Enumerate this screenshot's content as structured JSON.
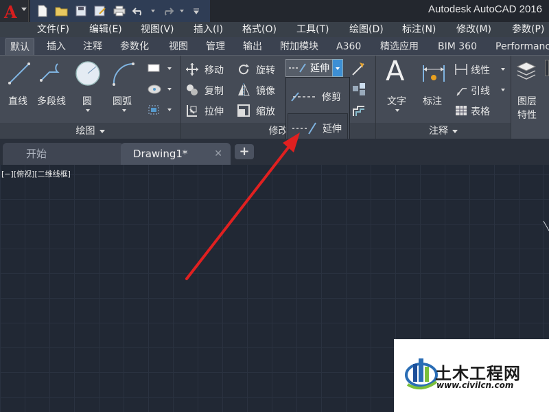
{
  "window": {
    "title": "Autodesk AutoCAD 2016"
  },
  "menu": [
    "文件(F)",
    "编辑(E)",
    "视图(V)",
    "插入(I)",
    "格式(O)",
    "工具(T)",
    "绘图(D)",
    "标注(N)",
    "修改(M)",
    "参数(P)"
  ],
  "tabs": [
    "默认",
    "插入",
    "注释",
    "参数化",
    "视图",
    "管理",
    "输出",
    "附加模块",
    "A360",
    "精选应用",
    "BIM 360",
    "Performance"
  ],
  "draw_panel": {
    "line": "直线",
    "polyline": "多段线",
    "circle": "圆",
    "arc": "圆弧",
    "footer": "绘图"
  },
  "modify_panel": {
    "move": "移动",
    "rotate": "旋转",
    "copy": "复制",
    "mirror": "镜像",
    "stretch": "拉伸",
    "scale": "缩放",
    "extend": "延伸",
    "footer": "修改"
  },
  "dropdown": {
    "trim": "修剪",
    "extend": "延伸"
  },
  "annotation_panel": {
    "text": "文字",
    "dimension": "标注",
    "linear": "线性",
    "leader": "引线",
    "table": "表格",
    "footer": "注释"
  },
  "layers_panel": {
    "layer_props_1": "图层",
    "layer_props_2": "特性"
  },
  "doc_tabs": {
    "start": "开始",
    "drawing": "Drawing1*",
    "close": "✕",
    "new": "+"
  },
  "viewport": {
    "label": "[−][俯视][二维线框]"
  },
  "watermark": {
    "name": "土木工程网",
    "url": "www.civilcn.com"
  }
}
